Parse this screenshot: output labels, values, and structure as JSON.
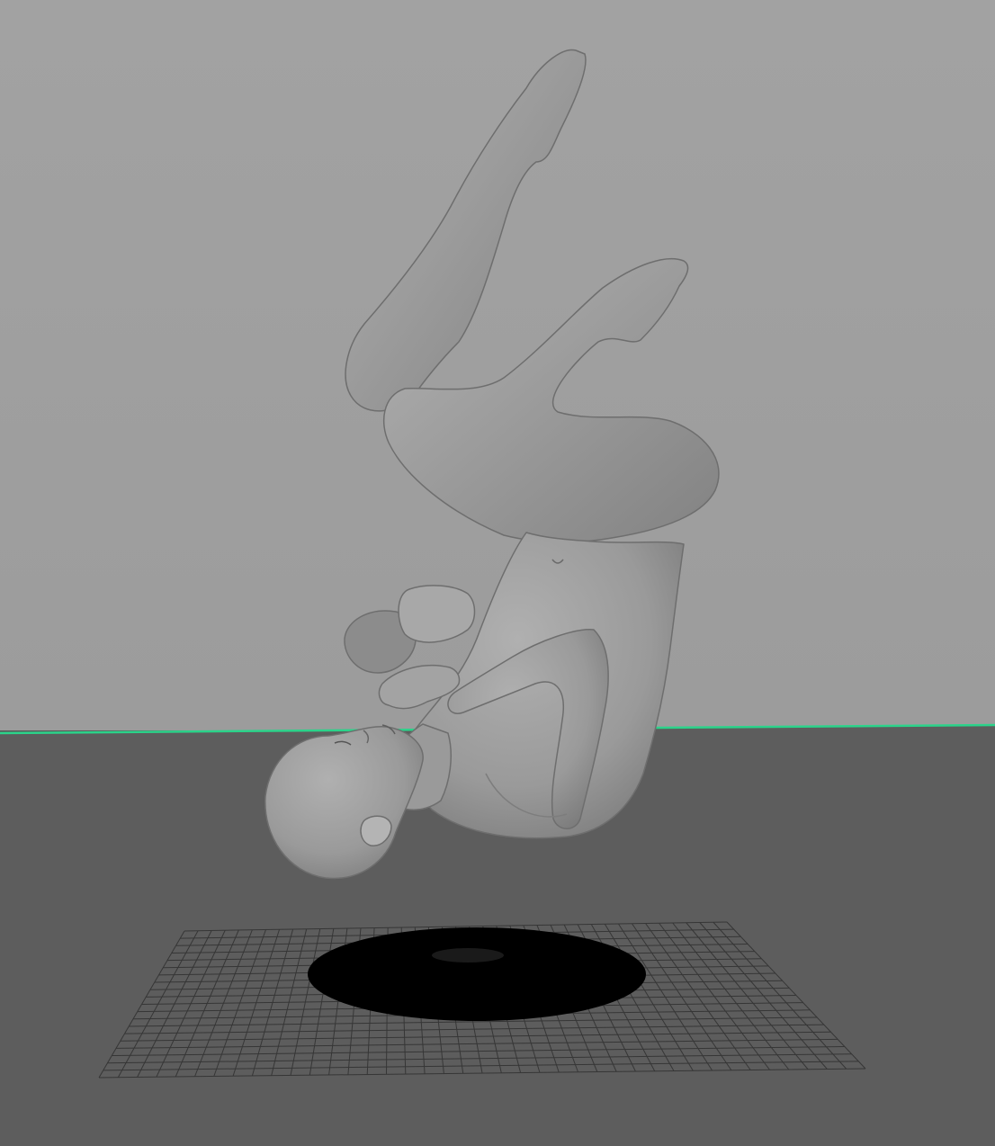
{
  "viewport": {
    "panel": "3D viewport",
    "background_color": "#a0a0a0",
    "floor_color": "#5f5f5f",
    "horizon_line_color": "#2bd38a",
    "grid_color": "#3a3a3a",
    "shadow_color": "#000000",
    "model_color": "#9b9b9b"
  },
  "scene": {
    "objects": [
      {
        "name": "female-base-mesh",
        "type": "mesh",
        "pose": "inverted-tuck"
      },
      {
        "name": "ground-grid",
        "type": "grid"
      },
      {
        "name": "contact-shadow",
        "type": "shadow"
      }
    ]
  }
}
